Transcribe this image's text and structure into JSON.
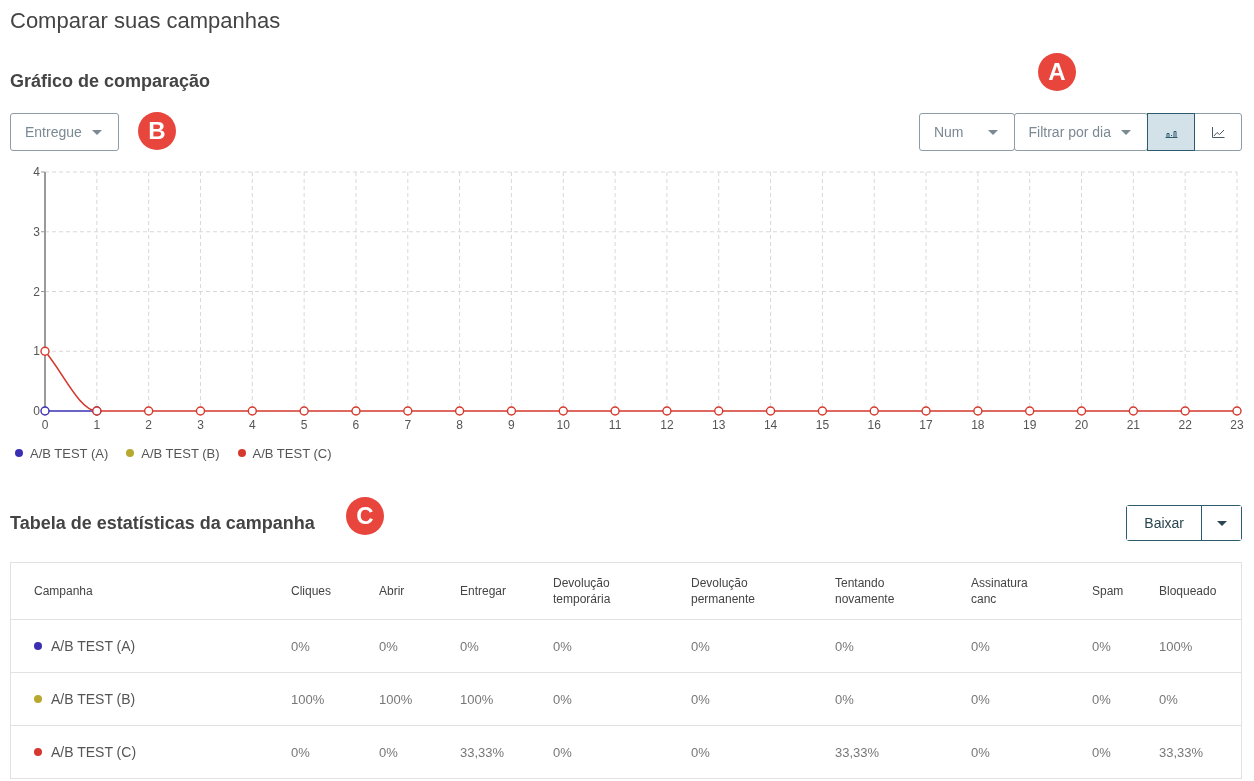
{
  "page_title": "Comparar suas campanhas",
  "chart_section": {
    "title": "Gráfico de comparação",
    "metric_dropdown": {
      "value": "Entregue"
    },
    "unit_dropdown": {
      "value": "Num"
    },
    "filter_dropdown": {
      "value": "Filtrar por dia"
    },
    "chart_type_toggles": [
      {
        "kind": "bar",
        "selected": true
      },
      {
        "kind": "line",
        "selected": false
      }
    ],
    "chart_data": {
      "type": "line",
      "grid": true,
      "xlim": [
        0,
        23
      ],
      "x": [
        0,
        1,
        2,
        3,
        4,
        5,
        6,
        7,
        8,
        9,
        10,
        11,
        12,
        13,
        14,
        15,
        16,
        17,
        18,
        19,
        20,
        21,
        22,
        23
      ],
      "xticks": [
        0,
        1,
        2,
        3,
        4,
        5,
        6,
        7,
        8,
        9,
        10,
        11,
        12,
        13,
        14,
        15,
        16,
        17,
        18,
        19,
        20,
        21,
        22,
        23
      ],
      "yticks": [
        0,
        1,
        2,
        3,
        4
      ],
      "ylim": [
        0,
        4
      ],
      "series": [
        {
          "name": "A/B TEST (A)",
          "color": "#3a2fb3",
          "marker": "circle",
          "values": [
            0,
            0,
            null,
            null,
            null,
            null,
            null,
            null,
            null,
            null,
            null,
            null,
            null,
            null,
            null,
            null,
            null,
            null,
            null,
            null,
            null,
            null,
            null,
            null
          ]
        },
        {
          "name": "A/B TEST (B)",
          "color": "#b9a830",
          "marker": "circle",
          "values": [
            null,
            null,
            null,
            null,
            null,
            null,
            null,
            null,
            null,
            null,
            null,
            null,
            null,
            null,
            null,
            null,
            null,
            null,
            null,
            null,
            null,
            null,
            null,
            null
          ]
        },
        {
          "name": "A/B TEST (C)",
          "color": "#d5382c",
          "marker": "circle",
          "values": [
            1,
            0,
            0,
            0,
            0,
            0,
            0,
            0,
            0,
            0,
            0,
            0,
            0,
            0,
            0,
            0,
            0,
            0,
            0,
            0,
            0,
            0,
            0,
            0
          ]
        }
      ]
    }
  },
  "stats_section": {
    "title": "Tabela de estatísticas da campanha",
    "download_button": {
      "label": "Baixar"
    },
    "table": {
      "columns": [
        "Campanha",
        "Cliques",
        "Abrir",
        "Entregar",
        "Devolução temporária",
        "Devolução permanente",
        "Tentando novamente",
        "Assinatura canc",
        "Spam",
        "Bloqueado"
      ],
      "rows": [
        {
          "color": "#3a2fb3",
          "cells": [
            "A/B TEST (A)",
            "0%",
            "0%",
            "0%",
            "0%",
            "0%",
            "0%",
            "0%",
            "0%",
            "100%"
          ]
        },
        {
          "color": "#b9a830",
          "cells": [
            "A/B TEST (B)",
            "100%",
            "100%",
            "100%",
            "0%",
            "0%",
            "0%",
            "0%",
            "0%",
            "0%"
          ]
        },
        {
          "color": "#d5382c",
          "cells": [
            "A/B TEST (C)",
            "0%",
            "0%",
            "33,33%",
            "0%",
            "0%",
            "33,33%",
            "0%",
            "0%",
            "33,33%"
          ]
        }
      ]
    }
  },
  "callouts": [
    {
      "label": "A"
    },
    {
      "label": "B"
    },
    {
      "label": "C"
    }
  ]
}
